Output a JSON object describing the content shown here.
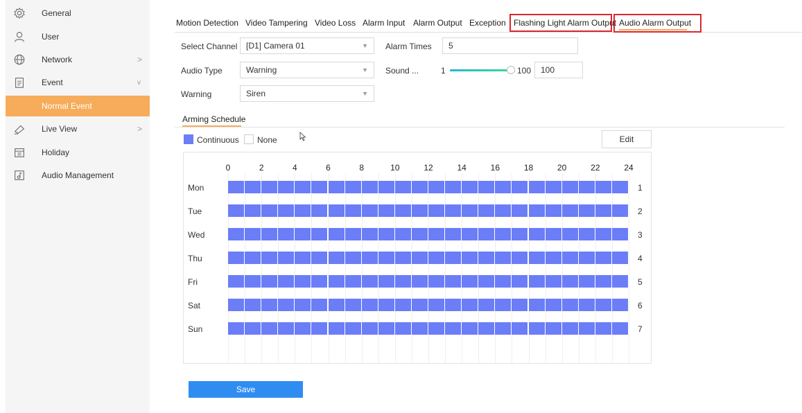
{
  "sidebar": {
    "items": [
      {
        "label": "General",
        "icon": "gear-icon",
        "chevron": ""
      },
      {
        "label": "User",
        "icon": "user-icon",
        "chevron": ""
      },
      {
        "label": "Network",
        "icon": "globe-icon",
        "chevron": ">"
      },
      {
        "label": "Event",
        "icon": "clipboard-icon",
        "chevron": "v"
      },
      {
        "label": "Normal Event",
        "icon": "",
        "chevron": ""
      },
      {
        "label": "Live View",
        "icon": "live-view-icon",
        "chevron": ">"
      },
      {
        "label": "Holiday",
        "icon": "calendar-icon",
        "chevron": ""
      },
      {
        "label": "Audio Management",
        "icon": "music-note-icon",
        "chevron": ""
      }
    ],
    "active_color": "#f6ac5a"
  },
  "tabs": [
    "Motion Detection",
    "Video Tampering",
    "Video Loss",
    "Alarm Input",
    "Alarm Output",
    "Exception",
    "Flashing Light Alarm Output",
    "Audio Alarm Output"
  ],
  "form": {
    "select_channel_label": "Select Channel",
    "select_channel_value": "[D1] Camera 01",
    "alarm_times_label": "Alarm Times",
    "alarm_times_value": "5",
    "audio_type_label": "Audio Type",
    "audio_type_value": "Warning",
    "sound_label": "Sound ...",
    "sound_min": "1",
    "sound_max": "100",
    "sound_value": "100",
    "warning_label": "Warning",
    "warning_value": "Siren"
  },
  "schedule": {
    "title": "Arming Schedule",
    "legend_continuous": "Continuous",
    "legend_none": "None",
    "edit_label": "Edit",
    "hours": [
      "0",
      "2",
      "4",
      "6",
      "8",
      "10",
      "12",
      "14",
      "16",
      "18",
      "20",
      "22",
      "24"
    ],
    "days": [
      {
        "name": "Mon",
        "num": "1"
      },
      {
        "name": "Tue",
        "num": "2"
      },
      {
        "name": "Wed",
        "num": "3"
      },
      {
        "name": "Thu",
        "num": "4"
      },
      {
        "name": "Fri",
        "num": "5"
      },
      {
        "name": "Sat",
        "num": "6"
      },
      {
        "name": "Sun",
        "num": "7"
      }
    ],
    "fill_color": "#6b7df7"
  },
  "save_label": "Save",
  "colors": {
    "accent": "#f6ac5a",
    "highlight": "#d9262c",
    "primary": "#2f8df1"
  }
}
